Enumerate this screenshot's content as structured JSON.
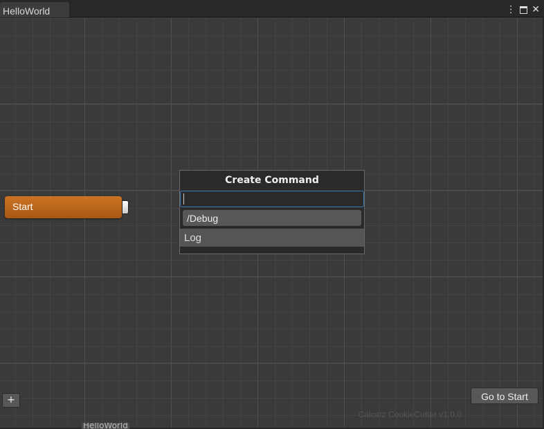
{
  "window": {
    "tab_title": "HelloWorld",
    "icons": [
      "more-vertical-icon",
      "maximize-icon",
      "close-icon"
    ]
  },
  "graph": {
    "start_node": {
      "label": "Start",
      "color": "#c06a1e"
    },
    "create_command": {
      "title": "Create Command",
      "search_value": "",
      "category": "/Debug",
      "items": [
        "Log"
      ]
    },
    "version_text": "Calcatz CookieCutter v1.0.0",
    "go_to_start_label": "Go to Start",
    "add_label": "+",
    "bottom_label": "HelloWorld"
  }
}
